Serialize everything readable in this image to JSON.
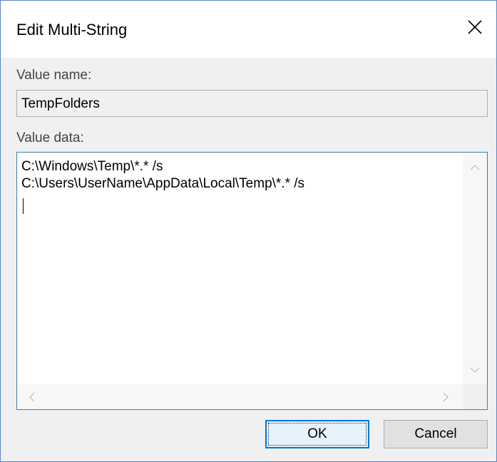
{
  "dialog": {
    "title": "Edit Multi-String",
    "close_icon": "close-icon"
  },
  "value_name": {
    "label": "Value name:",
    "value": "TempFolders"
  },
  "value_data": {
    "label": "Value data:",
    "lines": [
      "C:\\Windows\\Temp\\*.* /s",
      "C:\\Users\\UserName\\AppData\\Local\\Temp\\*.* /s"
    ],
    "text": "C:\\Windows\\Temp\\*.* /s\nC:\\Users\\UserName\\AppData\\Local\\Temp\\*.* /s"
  },
  "buttons": {
    "ok_label": "OK",
    "cancel_label": "Cancel"
  },
  "colors": {
    "accent": "#0078d7",
    "dialog_bg": "#f0f0f0",
    "border": "#5a87c5"
  }
}
